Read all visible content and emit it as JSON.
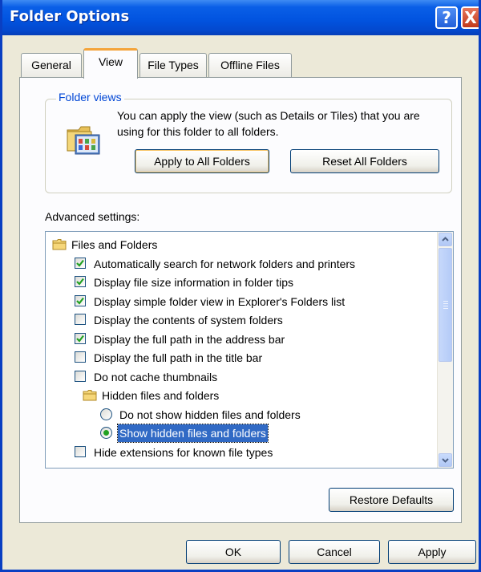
{
  "window": {
    "title": "Folder Options",
    "help_glyph": "?",
    "close_glyph": "X"
  },
  "tabs": [
    {
      "label": "General",
      "active": false
    },
    {
      "label": "View",
      "active": true
    },
    {
      "label": "File Types",
      "active": false
    },
    {
      "label": "Offline Files",
      "active": false
    }
  ],
  "folder_views": {
    "label": "Folder views",
    "description": "You can apply the view (such as Details or Tiles) that you are using for this folder to all folders.",
    "apply_all_label": "Apply to All Folders",
    "reset_all_label": "Reset All Folders"
  },
  "advanced": {
    "label": "Advanced settings:",
    "items": [
      {
        "type": "folder",
        "label": "Files and Folders"
      },
      {
        "type": "checkbox",
        "checked": true,
        "label": "Automatically search for network folders and printers"
      },
      {
        "type": "checkbox",
        "checked": true,
        "label": "Display file size information in folder tips"
      },
      {
        "type": "checkbox",
        "checked": true,
        "label": "Display simple folder view in Explorer's Folders list"
      },
      {
        "type": "checkbox",
        "checked": false,
        "label": "Display the contents of system folders"
      },
      {
        "type": "checkbox",
        "checked": true,
        "label": "Display the full path in the address bar"
      },
      {
        "type": "checkbox",
        "checked": false,
        "label": "Display the full path in the title bar"
      },
      {
        "type": "checkbox",
        "checked": false,
        "label": "Do not cache thumbnails"
      },
      {
        "type": "folder",
        "label": "Hidden files and folders"
      },
      {
        "type": "radio",
        "checked": false,
        "label": "Do not show hidden files and folders"
      },
      {
        "type": "radio",
        "checked": true,
        "selected": true,
        "label": "Show hidden files and folders"
      },
      {
        "type": "checkbox",
        "checked": false,
        "label": "Hide extensions for known file types"
      }
    ]
  },
  "buttons": {
    "restore_defaults": "Restore Defaults",
    "ok": "OK",
    "cancel": "Cancel",
    "apply": "Apply"
  },
  "colors": {
    "titlebar": "#0254e0",
    "selection": "#316ac5",
    "group_label": "#0046d5",
    "check_mark": "#21a121",
    "active_tab_accent": "#f4a43a"
  }
}
